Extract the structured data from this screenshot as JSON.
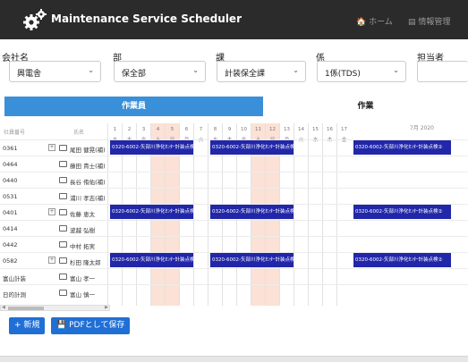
{
  "app": {
    "title": "Maintenance Service Scheduler",
    "nav_home": "ホーム",
    "nav_info": "情報管理"
  },
  "filters": [
    {
      "label": "会社名",
      "value": "興電舎"
    },
    {
      "label": "部",
      "value": "保全部"
    },
    {
      "label": "課",
      "value": "計装保全課"
    },
    {
      "label": "係",
      "value": "1係(TDS)"
    },
    {
      "label": "担当者",
      "value": ""
    }
  ],
  "tabs": {
    "worker": "作業員",
    "work": "作業"
  },
  "grid": {
    "header_id": "社員番号",
    "header_name": "氏名",
    "month_label": "7月 2020",
    "days": [
      {
        "d": "1",
        "w": "水"
      },
      {
        "d": "2",
        "w": "木"
      },
      {
        "d": "3",
        "w": "金"
      },
      {
        "d": "4",
        "w": "土"
      },
      {
        "d": "5",
        "w": "日"
      },
      {
        "d": "6",
        "w": "月"
      },
      {
        "d": "7",
        "w": "火"
      },
      {
        "d": "8",
        "w": "水"
      },
      {
        "d": "9",
        "w": "木"
      },
      {
        "d": "10",
        "w": "金"
      },
      {
        "d": "11",
        "w": "土"
      },
      {
        "d": "12",
        "w": "日"
      },
      {
        "d": "13",
        "w": "月"
      },
      {
        "d": "14",
        "w": "火"
      },
      {
        "d": "15",
        "w": "水"
      },
      {
        "d": "16",
        "w": "木"
      },
      {
        "d": "17",
        "w": "金"
      }
    ],
    "rows": [
      {
        "id": "0361",
        "name": "尾田 健晃(補)",
        "expandable": true
      },
      {
        "id": "0464",
        "name": "藤田 貴士(補)",
        "expandable": false
      },
      {
        "id": "0440",
        "name": "長谷 侑佑(補)",
        "expandable": false
      },
      {
        "id": "0531",
        "name": "浦川 孝志(補)",
        "expandable": false
      },
      {
        "id": "0401",
        "name": "佐藤 恵太",
        "expandable": true
      },
      {
        "id": "0414",
        "name": "波越 弘樹",
        "expandable": false
      },
      {
        "id": "0442",
        "name": "中村 拓実",
        "expandable": false
      },
      {
        "id": "0582",
        "name": "杉田 隆太郎",
        "expandable": true
      },
      {
        "id": "富山計装",
        "name": "富山 孝一",
        "expandable": false
      },
      {
        "id": "日的計測",
        "name": "富山 慎一",
        "expandable": false
      }
    ],
    "event_label": "0320-6002-矢部川浄化ｾﾝﾀｰ計装点検②"
  },
  "buttons": {
    "new": "+ 新規",
    "save_pdf": "PDFとして保存"
  }
}
